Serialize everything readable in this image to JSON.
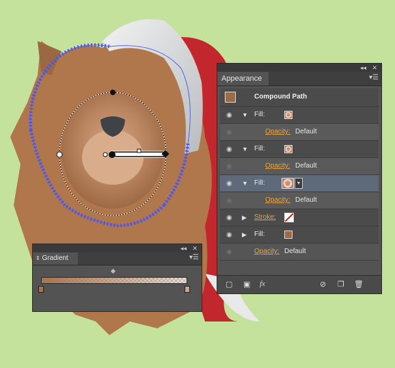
{
  "appearance": {
    "tab_label": "Appearance",
    "object_type": "Compound Path",
    "items": [
      {
        "kind": "fill",
        "label": "Fill:",
        "expanded": true,
        "swatch": "gradient"
      },
      {
        "kind": "sub",
        "label": "Opacity:",
        "value": "Default"
      },
      {
        "kind": "fill",
        "label": "Fill:",
        "expanded": true,
        "swatch": "gradient"
      },
      {
        "kind": "sub",
        "label": "Opacity:",
        "value": "Default"
      },
      {
        "kind": "fill",
        "label": "Fill:",
        "expanded": true,
        "swatch": "gradient",
        "selected": true
      },
      {
        "kind": "sub",
        "label": "Opacity:",
        "value": "Default"
      },
      {
        "kind": "stroke",
        "label": "Stroke:",
        "expanded": false,
        "swatch": "none"
      },
      {
        "kind": "fill",
        "label": "Fill:",
        "expanded": false,
        "swatch": "brown"
      },
      {
        "kind": "sub",
        "label": "Opacity:",
        "value": "Default"
      }
    ],
    "bottom_icons": [
      "new-stroke-icon",
      "new-fill-icon",
      "fx-icon",
      "clear-appearance-icon",
      "duplicate-item-icon",
      "delete-item-icon"
    ],
    "fx_label": "fx"
  },
  "gradient": {
    "tab_label": "Gradient",
    "stop_colors": [
      "#a6754f",
      "#c8a48e"
    ]
  },
  "colors": {
    "background": "#c5e29c",
    "fur": "#b0774d",
    "hat_red": "#c2272d",
    "selection_blue": "#5560f2"
  }
}
